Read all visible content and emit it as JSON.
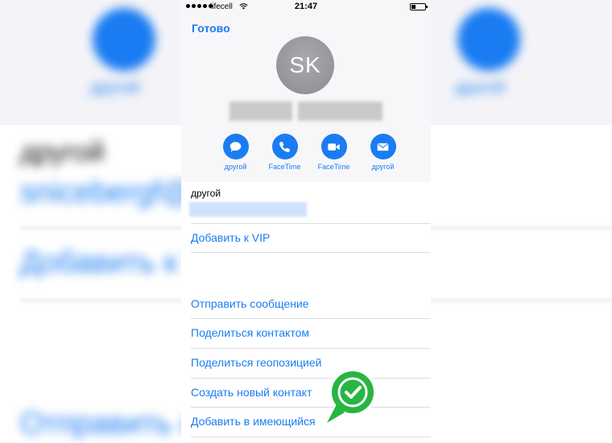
{
  "status_bar": {
    "carrier": "lifecell",
    "time": "21:47"
  },
  "nav": {
    "done_label": "Готово"
  },
  "contact": {
    "initials": "SK"
  },
  "actions": [
    {
      "label": "другой",
      "icon": "message-icon"
    },
    {
      "label": "FaceTime",
      "icon": "phone-icon"
    },
    {
      "label": "FaceTime",
      "icon": "video-icon"
    },
    {
      "label": "другой",
      "icon": "mail-icon"
    }
  ],
  "email": {
    "label": "другой"
  },
  "vip": {
    "label": "Добавить к VIP"
  },
  "menu": [
    "Отправить сообщение",
    "Поделиться контактом",
    "Поделиться геопозицией",
    "Создать новый контакт",
    "Добавить в имеющийся"
  ],
  "background": {
    "left_caption": "другой",
    "right_caption": "другой",
    "title": "другой",
    "vip": "Добавить к V",
    "send": "Отправить с"
  },
  "colors": {
    "accent": "#1a7cf2",
    "callout": "#27b543"
  }
}
